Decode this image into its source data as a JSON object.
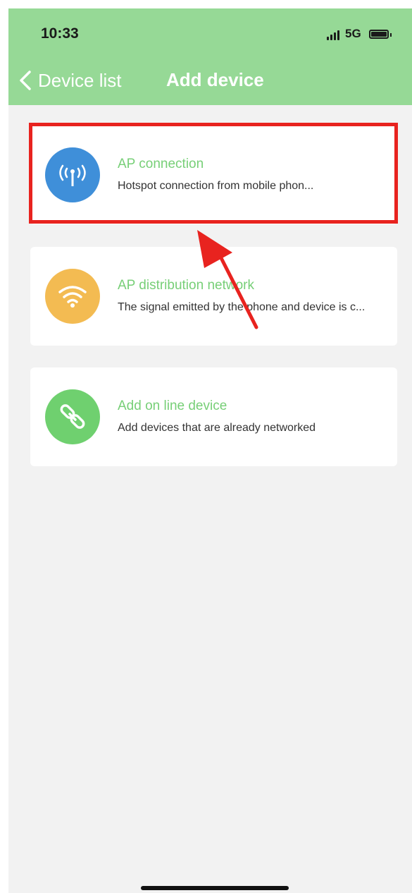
{
  "status_bar": {
    "time": "10:33",
    "network": "5G"
  },
  "nav": {
    "back_label": "Device list",
    "title": "Add device"
  },
  "options": [
    {
      "title": "AP connection",
      "description": "Hotspot connection from mobile phon...",
      "icon": "antenna-icon",
      "icon_color": "#3f8fd9"
    },
    {
      "title": "AP distribution network",
      "description": "The signal emitted by the phone and device is c...",
      "icon": "wifi-icon",
      "icon_color": "#f3bb52"
    },
    {
      "title": "Add on line device",
      "description": "Add devices that are already networked",
      "icon": "link-icon",
      "icon_color": "#6fd06f"
    }
  ],
  "colors": {
    "header": "#96d996",
    "accent_text": "#77cf77",
    "highlight": "#e8231f",
    "background": "#f2f2f2"
  }
}
